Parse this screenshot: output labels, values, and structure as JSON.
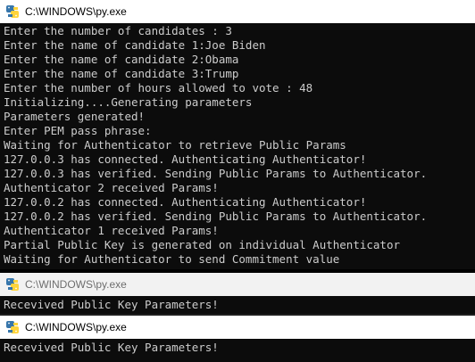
{
  "windows": [
    {
      "title": "C:\\WINDOWS\\py.exe",
      "icon": "python-icon",
      "lines": [
        "Enter the number of candidates : 3",
        "Enter the name of candidate 1:Joe Biden",
        "Enter the name of candidate 2:Obama",
        "Enter the name of candidate 3:Trump",
        "Enter the number of hours allowed to vote : 48",
        "Initializing....Generating parameters",
        "Parameters generated!",
        "Enter PEM pass phrase:",
        "Waiting for Authenticator to retrieve Public Params",
        "127.0.0.3 has connected. Authenticating Authenticator!",
        "127.0.0.3 has verified. Sending Public Params to Authenticator.",
        "Authenticator 2 received Params!",
        "127.0.0.2 has connected. Authenticating Authenticator!",
        "127.0.0.2 has verified. Sending Public Params to Authenticator.",
        "Authenticator 1 received Params!",
        "Partial Public Key is generated on individual Authenticator",
        "Waiting for Authenticator to send Commitment value"
      ]
    },
    {
      "title": "C:\\WINDOWS\\py.exe",
      "icon": "python-icon",
      "lines": [
        "Recevived Public Key Parameters!"
      ]
    },
    {
      "title": "C:\\WINDOWS\\py.exe",
      "icon": "python-icon",
      "lines": [
        "Recevived Public Key Parameters!"
      ]
    }
  ],
  "colors": {
    "console_background": "#0c0c0c",
    "console_text": "#cccccc",
    "titlebar_active": "#ffffff",
    "titlebar_inactive": "#f2f2f2",
    "python_blue": "#3776ab",
    "python_yellow": "#ffd43b"
  }
}
